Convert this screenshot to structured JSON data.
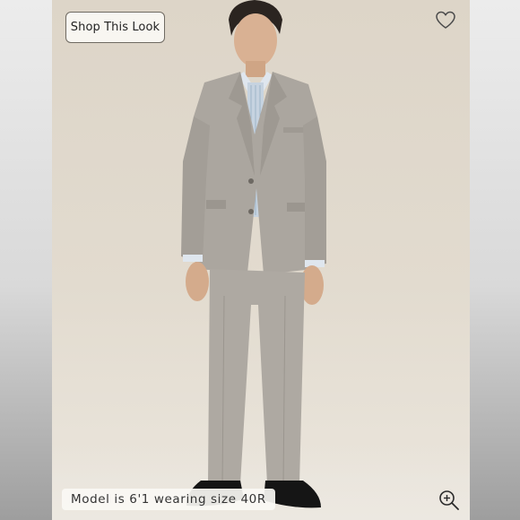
{
  "product_image": {
    "shop_look_label": "Shop This Look",
    "model_caption": "Model is 6'1 wearing size 40R",
    "favorite_icon": "heart-outline-icon",
    "zoom_icon": "zoom-in-icon",
    "colors": {
      "background": "#e0d9cd",
      "suit": "#a9a49d",
      "shirt": "#c9d5e0"
    }
  }
}
